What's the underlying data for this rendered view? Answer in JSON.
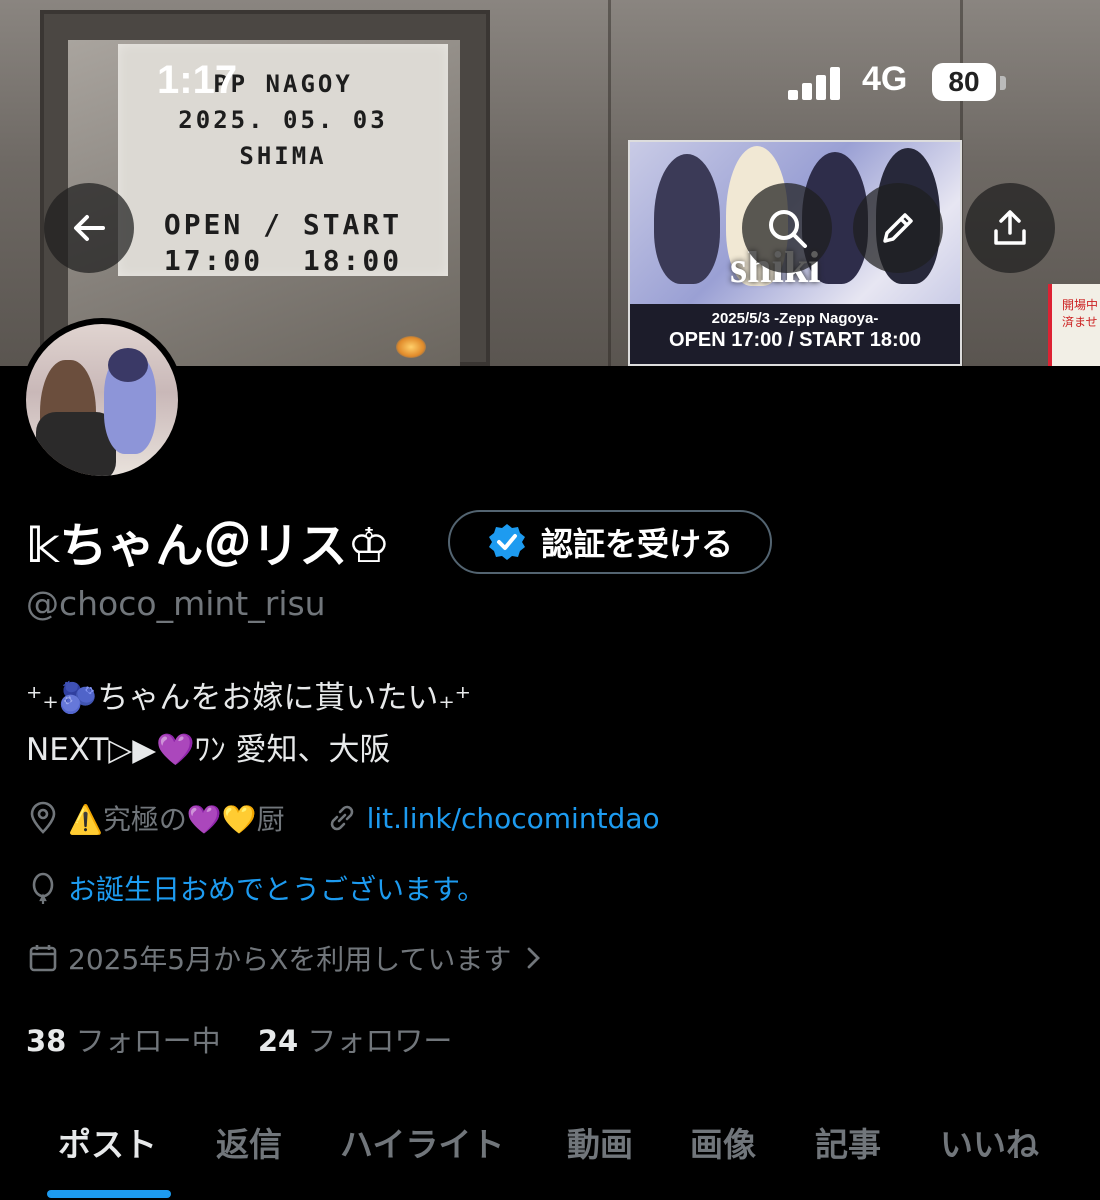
{
  "status_bar": {
    "time": "1:17",
    "network": "4G",
    "battery": "80"
  },
  "banner": {
    "marquee_lines": [
      "PP NAGOY",
      "2025. 05. 03",
      "SHIMA",
      "OPEN / START",
      "17:00  18:00"
    ],
    "poster_title": "shiki",
    "poster_line1": "2025/5/3 -Zepp Nagoya-",
    "poster_line2": "OPEN 17:00 / START 18:00",
    "sign_text": "開場中 済ませ"
  },
  "profile": {
    "display_name": "𝕜ちゃん＠リス♔",
    "verify_label": "認証を受ける",
    "handle": "@choco_mint_risu",
    "bio_line1": "⁺₊🫐ちゃんをお嫁に貰いたい₊⁺",
    "bio_line2": "NEXT▷▶💜ﾜﾝ 愛知、大阪",
    "location": "⚠️究極の💜💛厨",
    "website": "lit.link/chocomintdao",
    "birthday": "お誕生日おめでとうございます。",
    "joined": "2025年5月からXを利用しています",
    "following_count": "38",
    "following_label": "フォロー中",
    "followers_count": "24",
    "followers_label": "フォロワー"
  },
  "tabs": [
    "ポスト",
    "返信",
    "ハイライト",
    "動画",
    "画像",
    "記事",
    "いいね"
  ],
  "active_tab": "ポスト",
  "colors": {
    "accent": "#1d9bf0",
    "muted": "#71767b",
    "background": "#000000"
  },
  "icons": [
    "back-arrow-icon",
    "search-icon",
    "pencil-icon",
    "share-icon",
    "verified-badge-icon",
    "location-icon",
    "link-icon",
    "balloon-icon",
    "calendar-icon",
    "chevron-right-icon"
  ]
}
